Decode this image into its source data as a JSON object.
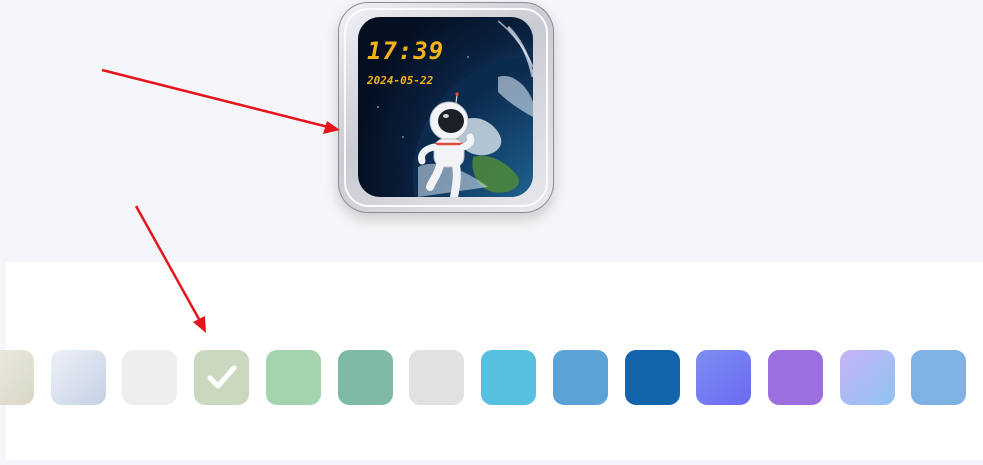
{
  "watch_face": {
    "time": "17:39",
    "date": "2024-05-22",
    "theme_colors": {
      "digits": "#f5b31a",
      "background": "#0a2140"
    }
  },
  "color_swatches": [
    {
      "color": "linear-gradient(135deg,#ecebe0,#d9d8c6)",
      "selected": false
    },
    {
      "color": "linear-gradient(135deg,#eef1f7,#c5d0e4)",
      "selected": false
    },
    {
      "color": "#eeeeee",
      "selected": false
    },
    {
      "color": "#c9d8be",
      "selected": true
    },
    {
      "color": "#a3d4ae",
      "selected": false
    },
    {
      "color": "#7fbaa7",
      "selected": false
    },
    {
      "color": "#e0e1e3",
      "selected": false
    },
    {
      "color": "#56c0de",
      "selected": false
    },
    {
      "color": "#5ba2d6",
      "selected": false
    },
    {
      "color": "#1464ac",
      "selected": false
    },
    {
      "color": "linear-gradient(135deg,#7f8df0,#6a6af4)",
      "selected": false
    },
    {
      "color": "#9b6fde",
      "selected": false
    },
    {
      "color": "linear-gradient(135deg,#c6b4f8,#8fc2ef)",
      "selected": false
    },
    {
      "color": "#7fb2e2",
      "selected": false
    }
  ],
  "annotation_color": "#e8141c"
}
